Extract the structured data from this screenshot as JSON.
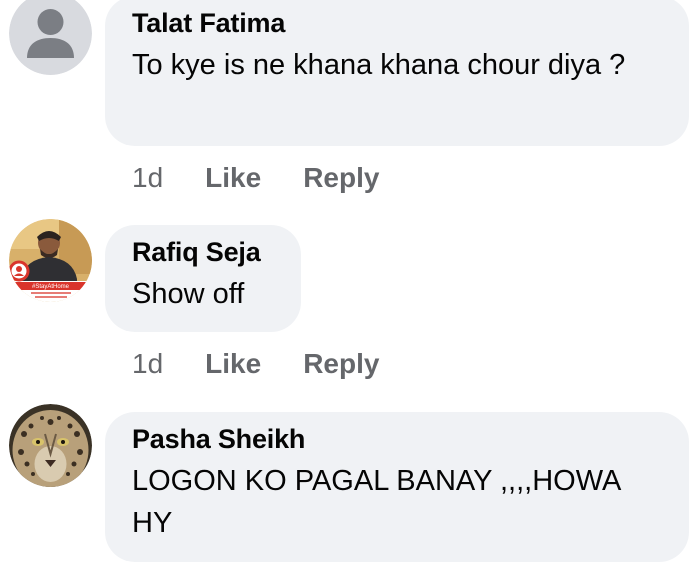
{
  "comments": [
    {
      "author": "Talat Fatima",
      "text": "To kye is ne khana khana chour diya ?",
      "time": "1d",
      "like_label": "Like",
      "reply_label": "Reply",
      "avatar_icon": "default-person-avatar"
    },
    {
      "author": "Rafiq Seja",
      "text": "Show off",
      "time": "1d",
      "like_label": "Like",
      "reply_label": "Reply",
      "avatar_icon": "profile-photo-stay-at-home-frame",
      "avatar_frame_text": "#StayAtHome"
    },
    {
      "author": "Pasha Sheikh",
      "text": "LOGON KO PAGAL BANAY ,,,,HOWA HY",
      "avatar_icon": "leopard-photo-avatar"
    }
  ],
  "colors": {
    "bubble_bg": "#f0f2f5",
    "name_text": "#050505",
    "secondary_text": "#65676b",
    "frame_red": "#d9342b"
  }
}
